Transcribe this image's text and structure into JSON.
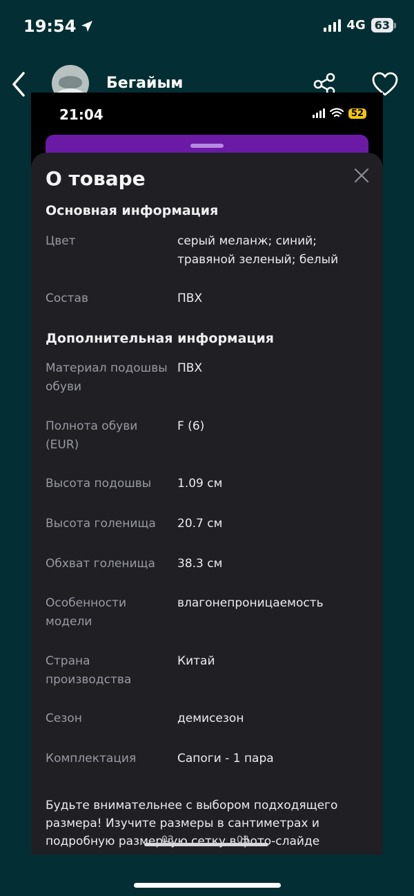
{
  "outer_status": {
    "time": "19:54",
    "network": "4G",
    "battery": "63"
  },
  "outer_header": {
    "user_name": "Бегайым"
  },
  "inner_status": {
    "time": "21:04",
    "battery": "52"
  },
  "sheet": {
    "title": "О товаре",
    "sections": [
      {
        "title": "Основная информация",
        "rows": [
          {
            "label": "Цвет",
            "value": "серый меланж; синий; травяной зеленый; белый"
          },
          {
            "label": "Состав",
            "value": "ПВХ"
          }
        ]
      },
      {
        "title": "Дополнительная информация",
        "rows": [
          {
            "label": "Материал подошвы обуви",
            "value": "ПВХ"
          },
          {
            "label": "Полнота обуви (EUR)",
            "value": "F (6)"
          },
          {
            "label": "Высота подошвы",
            "value": "1.09 см"
          },
          {
            "label": "Высота голенища",
            "value": "20.7 см"
          },
          {
            "label": "Обхват голенища",
            "value": "38.3 см"
          },
          {
            "label": "Особенности модели",
            "value": "влагонепроницаемость"
          },
          {
            "label": "Страна производства",
            "value": "Китай"
          },
          {
            "label": "Сезон",
            "value": "демисезон"
          },
          {
            "label": "Комплектация",
            "value": "Сапоги - 1 пара"
          }
        ]
      }
    ],
    "note": "Будьте внимательнее с выбором подходящего размера! Изучите размеры в сантиметрах и подробную размерную сетку в фото-слайде",
    "overlay_left": "03",
    "overlay_right": "03"
  },
  "colors": {
    "background": "#032e33",
    "sheet": "#1f1f24",
    "accent_purple": "#6b1aa6",
    "battery_yellow": "#f1c40f"
  },
  "icons": [
    "location-arrow-icon",
    "signal-icon",
    "back-chevron-icon",
    "share-icon",
    "heart-icon",
    "wifi-icon",
    "close-icon"
  ]
}
